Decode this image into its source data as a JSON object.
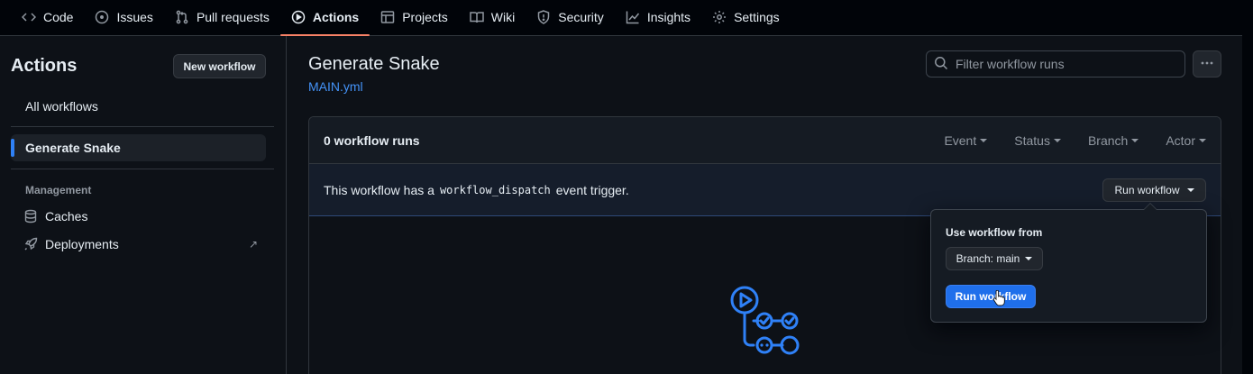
{
  "nav": {
    "tabs": [
      {
        "label": "Code",
        "icon": "code-icon"
      },
      {
        "label": "Issues",
        "icon": "issue-icon"
      },
      {
        "label": "Pull requests",
        "icon": "pull-request-icon"
      },
      {
        "label": "Actions",
        "icon": "play-icon",
        "active": true
      },
      {
        "label": "Projects",
        "icon": "table-icon"
      },
      {
        "label": "Wiki",
        "icon": "book-icon"
      },
      {
        "label": "Security",
        "icon": "shield-icon"
      },
      {
        "label": "Insights",
        "icon": "graph-icon"
      },
      {
        "label": "Settings",
        "icon": "gear-icon"
      }
    ]
  },
  "sidebar": {
    "title": "Actions",
    "new_workflow": "New workflow",
    "items": [
      {
        "label": "All workflows"
      },
      {
        "label": "Generate Snake",
        "active": true
      }
    ],
    "management_label": "Management",
    "management": [
      {
        "label": "Caches",
        "icon": "database-icon"
      },
      {
        "label": "Deployments",
        "icon": "rocket-icon",
        "external": "↗"
      }
    ]
  },
  "main": {
    "title": "Generate Snake",
    "file": "MAIN.yml",
    "filter_placeholder": "Filter workflow runs",
    "runs_count": "0 workflow runs",
    "filters": [
      "Event",
      "Status",
      "Branch",
      "Actor"
    ],
    "dispatch": {
      "prefix": "This workflow has a",
      "code": "workflow_dispatch",
      "suffix": "event trigger.",
      "button": "Run workflow"
    }
  },
  "popover": {
    "label": "Use workflow from",
    "branch": "Branch: main",
    "submit": "Run workflow"
  },
  "colors": {
    "accent": "#f78166",
    "link": "#4493f8",
    "primary": "#1f6feb",
    "workflow_icon": "#2f81f7"
  }
}
